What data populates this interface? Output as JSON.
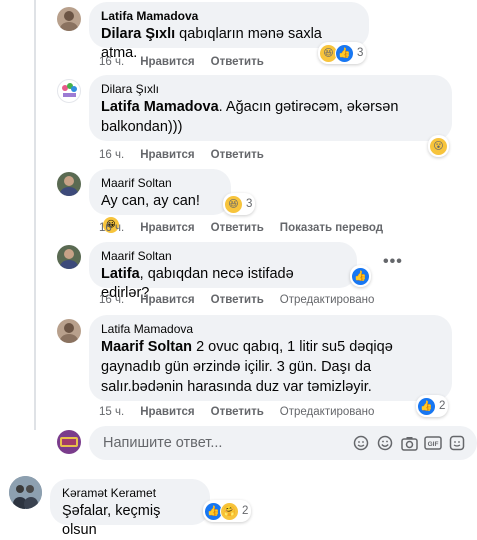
{
  "comments": [
    {
      "author": "Latifa Mamadova",
      "mention": "Dilara Şıxlı",
      "text": " qabıqların mənə saxla atma.",
      "time": "16 ч.",
      "like": "Нравится",
      "reply": "Ответить",
      "reaction_count": "3"
    },
    {
      "author": "Dilara Şıxlı",
      "mention": "Latifa Mamadova",
      "text": ". Ağacın gətirəcəm, əkərsən",
      "text2": "balkondan)))",
      "time": "16 ч.",
      "like": "Нравится",
      "reply": "Ответить"
    },
    {
      "author": "Maarif Soltan",
      "text": "Ay can, ay can!",
      "time": "16 ч.",
      "like": "Нравится",
      "reply": "Ответить",
      "translate": "Показать перевод",
      "reaction_count": "3"
    },
    {
      "author": "Maarif Soltan",
      "mention": "Latifa",
      "text": ", qabıqdan necə istifadə edirlər?",
      "time": "16 ч.",
      "like": "Нравится",
      "reply": "Ответить",
      "edited": "Отредактировано"
    },
    {
      "author": "Latifa Mamadova",
      "mention": "Maarif Soltan",
      "text": " 2 ovuc qabıq, 1 litir su5 dəqiqə",
      "text2": "gaynadıb gün ərzində içilir. 3 gün. Daşı da",
      "text3": "salır.bədənin harasında duz var təmizləyir.",
      "time": "15 ч.",
      "like": "Нравится",
      "reply": "Ответить",
      "edited": "Отредактировано",
      "reaction_count": "2"
    }
  ],
  "reply_box": {
    "placeholder": "Напишите ответ..."
  },
  "bottom_comment": {
    "author": "Kəramət Keramet",
    "text": "Şəfalar, keçmiş olsun",
    "reaction_count": "2"
  },
  "colors": {
    "like_blue": "#1877f2",
    "bubble_gray": "#f0f2f5",
    "meta_gray": "#65676b"
  }
}
